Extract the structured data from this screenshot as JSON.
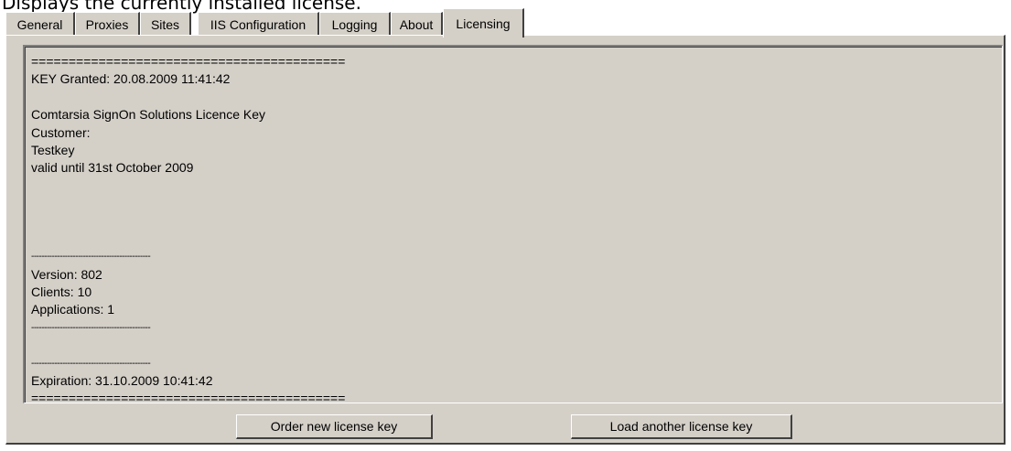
{
  "caption": "Displays the currently installed license.",
  "tabs": [
    {
      "label": "General"
    },
    {
      "label": "Proxies"
    },
    {
      "label": "Sites"
    },
    {
      "label": "IIS Configuration"
    },
    {
      "label": "Logging"
    },
    {
      "label": "About"
    },
    {
      "label": "Licensing",
      "active": true
    }
  ],
  "license_text": {
    "lines": [
      "==========================================",
      "KEY Granted: 20.08.2009 11:41:42",
      "",
      "Comtarsia SignOn Solutions Licence Key",
      "Customer:",
      "Testkey",
      "valid until 31st October 2009",
      "",
      "",
      "",
      "",
      "----------------------------------------------",
      "Version: 802",
      "Clients: 10",
      "Applications: 1",
      "----------------------------------------------",
      "",
      "----------------------------------------------",
      "Expiration: 31.10.2009 10:41:42",
      "==========================================",
      ""
    ]
  },
  "buttons": {
    "order_label": "Order new license key",
    "load_label": "Load another license key"
  },
  "colors": {
    "dialog_bg": "#d4d0c8",
    "highlight": "#ffffff",
    "shadow": "#404040"
  }
}
